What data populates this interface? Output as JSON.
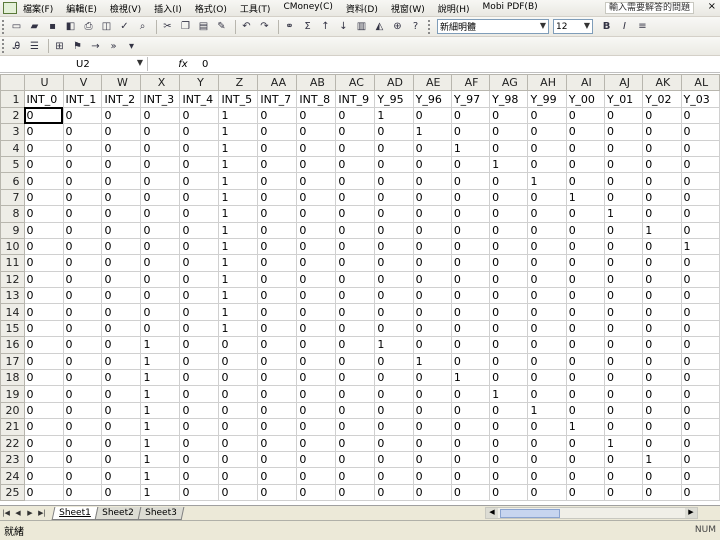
{
  "menubar": {
    "items": [
      "檔案(F)",
      "編輯(E)",
      "檢視(V)",
      "插入(I)",
      "格式(O)",
      "工具(T)",
      "CMoney(C)",
      "資料(D)",
      "視窗(W)",
      "說明(H)",
      "Mobi PDF(B)"
    ],
    "help_placeholder": "輸入需要解答的問題",
    "close": "×"
  },
  "toolbar": {
    "font_name": "新細明體",
    "font_size": "12",
    "bold": "B",
    "italic": "I"
  },
  "formula_bar": {
    "name_box": "U2",
    "fx": "fx",
    "value": "0"
  },
  "grid": {
    "columns": [
      "U",
      "V",
      "W",
      "X",
      "Y",
      "Z",
      "AA",
      "AB",
      "AC",
      "AD",
      "AE",
      "AF",
      "AG",
      "AH",
      "AI",
      "AJ",
      "AK",
      "AL"
    ],
    "active_column": "U",
    "active_row": "2",
    "rows": [
      {
        "n": "1",
        "cells": [
          "INT_0",
          "INT_1",
          "INT_2",
          "INT_3",
          "INT_4",
          "INT_5",
          "INT_7",
          "INT_8",
          "INT_9",
          "Y_95",
          "Y_96",
          "Y_97",
          "Y_98",
          "Y_99",
          "Y_00",
          "Y_01",
          "Y_02",
          "Y_03"
        ]
      },
      {
        "n": "2",
        "cells": [
          "0",
          "0",
          "0",
          "0",
          "0",
          "1",
          "0",
          "0",
          "0",
          "1",
          "0",
          "0",
          "0",
          "0",
          "0",
          "0",
          "0",
          "0"
        ]
      },
      {
        "n": "3",
        "cells": [
          "0",
          "0",
          "0",
          "0",
          "0",
          "1",
          "0",
          "0",
          "0",
          "0",
          "1",
          "0",
          "0",
          "0",
          "0",
          "0",
          "0",
          "0"
        ]
      },
      {
        "n": "4",
        "cells": [
          "0",
          "0",
          "0",
          "0",
          "0",
          "1",
          "0",
          "0",
          "0",
          "0",
          "0",
          "1",
          "0",
          "0",
          "0",
          "0",
          "0",
          "0"
        ]
      },
      {
        "n": "5",
        "cells": [
          "0",
          "0",
          "0",
          "0",
          "0",
          "1",
          "0",
          "0",
          "0",
          "0",
          "0",
          "0",
          "1",
          "0",
          "0",
          "0",
          "0",
          "0"
        ]
      },
      {
        "n": "6",
        "cells": [
          "0",
          "0",
          "0",
          "0",
          "0",
          "1",
          "0",
          "0",
          "0",
          "0",
          "0",
          "0",
          "0",
          "1",
          "0",
          "0",
          "0",
          "0"
        ]
      },
      {
        "n": "7",
        "cells": [
          "0",
          "0",
          "0",
          "0",
          "0",
          "1",
          "0",
          "0",
          "0",
          "0",
          "0",
          "0",
          "0",
          "0",
          "1",
          "0",
          "0",
          "0"
        ]
      },
      {
        "n": "8",
        "cells": [
          "0",
          "0",
          "0",
          "0",
          "0",
          "1",
          "0",
          "0",
          "0",
          "0",
          "0",
          "0",
          "0",
          "0",
          "0",
          "1",
          "0",
          "0"
        ]
      },
      {
        "n": "9",
        "cells": [
          "0",
          "0",
          "0",
          "0",
          "0",
          "1",
          "0",
          "0",
          "0",
          "0",
          "0",
          "0",
          "0",
          "0",
          "0",
          "0",
          "1",
          "0"
        ]
      },
      {
        "n": "10",
        "cells": [
          "0",
          "0",
          "0",
          "0",
          "0",
          "1",
          "0",
          "0",
          "0",
          "0",
          "0",
          "0",
          "0",
          "0",
          "0",
          "0",
          "0",
          "1"
        ]
      },
      {
        "n": "11",
        "cells": [
          "0",
          "0",
          "0",
          "0",
          "0",
          "1",
          "0",
          "0",
          "0",
          "0",
          "0",
          "0",
          "0",
          "0",
          "0",
          "0",
          "0",
          "0"
        ]
      },
      {
        "n": "12",
        "cells": [
          "0",
          "0",
          "0",
          "0",
          "0",
          "1",
          "0",
          "0",
          "0",
          "0",
          "0",
          "0",
          "0",
          "0",
          "0",
          "0",
          "0",
          "0"
        ]
      },
      {
        "n": "13",
        "cells": [
          "0",
          "0",
          "0",
          "0",
          "0",
          "1",
          "0",
          "0",
          "0",
          "0",
          "0",
          "0",
          "0",
          "0",
          "0",
          "0",
          "0",
          "0"
        ]
      },
      {
        "n": "14",
        "cells": [
          "0",
          "0",
          "0",
          "0",
          "0",
          "1",
          "0",
          "0",
          "0",
          "0",
          "0",
          "0",
          "0",
          "0",
          "0",
          "0",
          "0",
          "0"
        ]
      },
      {
        "n": "15",
        "cells": [
          "0",
          "0",
          "0",
          "0",
          "0",
          "1",
          "0",
          "0",
          "0",
          "0",
          "0",
          "0",
          "0",
          "0",
          "0",
          "0",
          "0",
          "0"
        ]
      },
      {
        "n": "16",
        "cells": [
          "0",
          "0",
          "0",
          "1",
          "0",
          "0",
          "0",
          "0",
          "0",
          "1",
          "0",
          "0",
          "0",
          "0",
          "0",
          "0",
          "0",
          "0"
        ]
      },
      {
        "n": "17",
        "cells": [
          "0",
          "0",
          "0",
          "1",
          "0",
          "0",
          "0",
          "0",
          "0",
          "0",
          "1",
          "0",
          "0",
          "0",
          "0",
          "0",
          "0",
          "0"
        ]
      },
      {
        "n": "18",
        "cells": [
          "0",
          "0",
          "0",
          "1",
          "0",
          "0",
          "0",
          "0",
          "0",
          "0",
          "0",
          "1",
          "0",
          "0",
          "0",
          "0",
          "0",
          "0"
        ]
      },
      {
        "n": "19",
        "cells": [
          "0",
          "0",
          "0",
          "1",
          "0",
          "0",
          "0",
          "0",
          "0",
          "0",
          "0",
          "0",
          "1",
          "0",
          "0",
          "0",
          "0",
          "0"
        ]
      },
      {
        "n": "20",
        "cells": [
          "0",
          "0",
          "0",
          "1",
          "0",
          "0",
          "0",
          "0",
          "0",
          "0",
          "0",
          "0",
          "0",
          "1",
          "0",
          "0",
          "0",
          "0"
        ]
      },
      {
        "n": "21",
        "cells": [
          "0",
          "0",
          "0",
          "1",
          "0",
          "0",
          "0",
          "0",
          "0",
          "0",
          "0",
          "0",
          "0",
          "0",
          "1",
          "0",
          "0",
          "0"
        ]
      },
      {
        "n": "22",
        "cells": [
          "0",
          "0",
          "0",
          "1",
          "0",
          "0",
          "0",
          "0",
          "0",
          "0",
          "0",
          "0",
          "0",
          "0",
          "0",
          "1",
          "0",
          "0"
        ]
      },
      {
        "n": "23",
        "cells": [
          "0",
          "0",
          "0",
          "1",
          "0",
          "0",
          "0",
          "0",
          "0",
          "0",
          "0",
          "0",
          "0",
          "0",
          "0",
          "0",
          "1",
          "0"
        ]
      },
      {
        "n": "24",
        "cells": [
          "0",
          "0",
          "0",
          "1",
          "0",
          "0",
          "0",
          "0",
          "0",
          "0",
          "0",
          "0",
          "0",
          "0",
          "0",
          "0",
          "0",
          "0"
        ]
      },
      {
        "n": "25",
        "cells": [
          "0",
          "0",
          "0",
          "1",
          "0",
          "0",
          "0",
          "0",
          "0",
          "0",
          "0",
          "0",
          "0",
          "0",
          "0",
          "0",
          "0",
          "0"
        ]
      }
    ]
  },
  "sheet_tabs": [
    "Sheet1",
    "Sheet2",
    "Sheet3"
  ],
  "active_sheet": "Sheet1",
  "status": {
    "left": "就緒",
    "right": "NUM"
  }
}
